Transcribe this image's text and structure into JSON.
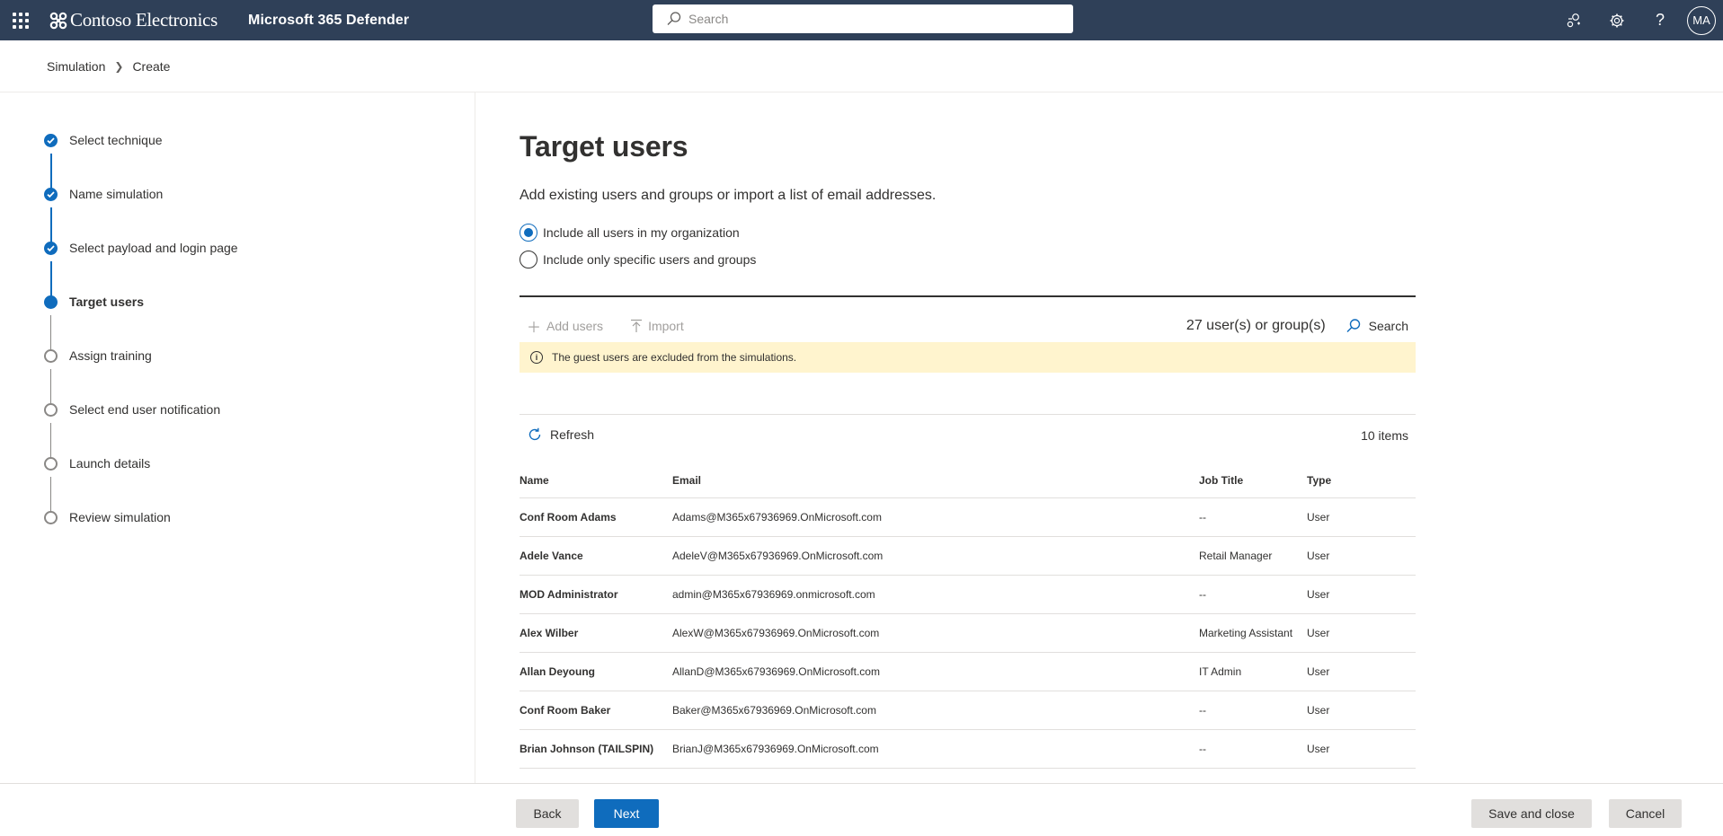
{
  "topbar": {
    "brand": "Contoso Electronics",
    "product": "Microsoft 365 Defender",
    "search_placeholder": "Search",
    "avatar_initials": "MA",
    "icons": [
      "share-icon",
      "gear-icon",
      "help-icon"
    ],
    "bg_color": "#2f4058"
  },
  "breadcrumb": {
    "items": [
      "Simulation",
      "Create"
    ]
  },
  "wizard": {
    "steps": [
      {
        "label": "Select technique",
        "state": "done"
      },
      {
        "label": "Name simulation",
        "state": "done"
      },
      {
        "label": "Select payload and login page",
        "state": "done"
      },
      {
        "label": "Target users",
        "state": "current"
      },
      {
        "label": "Assign training",
        "state": "todo"
      },
      {
        "label": "Select end user notification",
        "state": "todo"
      },
      {
        "label": "Launch details",
        "state": "todo"
      },
      {
        "label": "Review simulation",
        "state": "todo"
      }
    ],
    "accent": "#0f6cbd"
  },
  "main": {
    "title": "Target users",
    "subtitle": "Add existing users and groups or import a list of email addresses.",
    "options": [
      {
        "label": "Include all users in my organization",
        "checked": true
      },
      {
        "label": "Include only specific users and groups",
        "checked": false
      }
    ],
    "commands": {
      "add_users": "Add users",
      "import": "Import",
      "count": "27 user(s) or group(s)",
      "search": "Search"
    },
    "banner": "The guest users are excluded from the simulations.",
    "refresh": "Refresh",
    "items_count": "10 items",
    "table": {
      "columns": [
        "Name",
        "Email",
        "Job Title",
        "Type"
      ],
      "rows": [
        {
          "name": "Conf Room Adams",
          "email": "Adams@M365x67936969.OnMicrosoft.com",
          "job": "--",
          "type": "User"
        },
        {
          "name": "Adele Vance",
          "email": "AdeleV@M365x67936969.OnMicrosoft.com",
          "job": "Retail Manager",
          "type": "User"
        },
        {
          "name": "MOD Administrator",
          "email": "admin@M365x67936969.onmicrosoft.com",
          "job": "--",
          "type": "User"
        },
        {
          "name": "Alex Wilber",
          "email": "AlexW@M365x67936969.OnMicrosoft.com",
          "job": "Marketing Assistant",
          "type": "User"
        },
        {
          "name": "Allan Deyoung",
          "email": "AllanD@M365x67936969.OnMicrosoft.com",
          "job": "IT Admin",
          "type": "User"
        },
        {
          "name": "Conf Room Baker",
          "email": "Baker@M365x67936969.OnMicrosoft.com",
          "job": "--",
          "type": "User"
        },
        {
          "name": "Brian Johnson (TAILSPIN)",
          "email": "BrianJ@M365x67936969.OnMicrosoft.com",
          "job": "--",
          "type": "User"
        }
      ]
    }
  },
  "footer": {
    "back": "Back",
    "next": "Next",
    "save_close": "Save and close",
    "cancel": "Cancel"
  }
}
